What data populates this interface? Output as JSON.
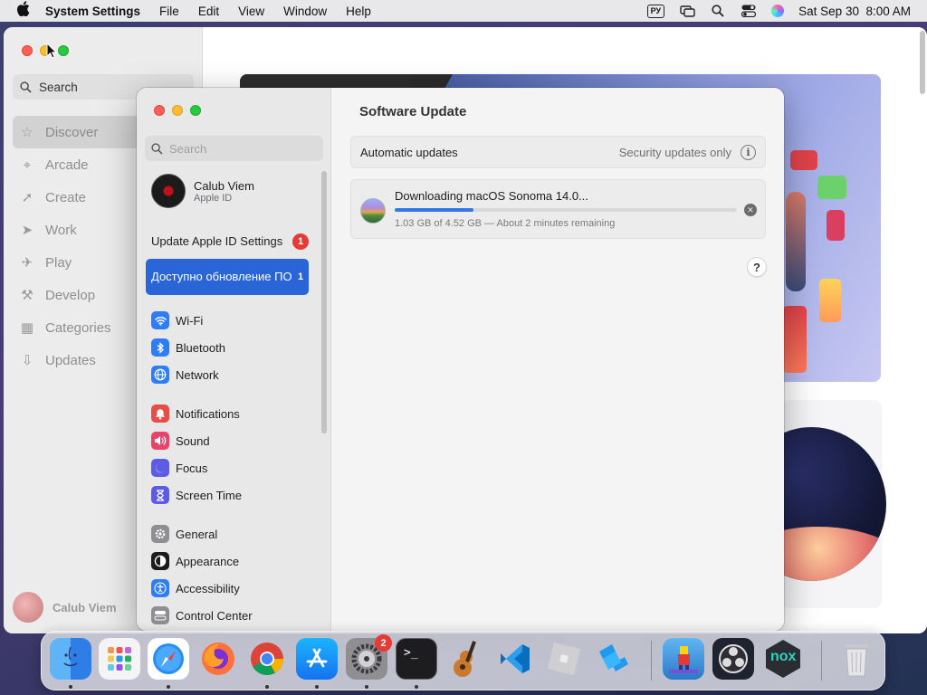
{
  "menubar": {
    "app_name": "System Settings",
    "menus": [
      "File",
      "Edit",
      "View",
      "Window",
      "Help"
    ],
    "input_source": "РУ",
    "datetime": "Sat Sep 30  8:00 AM"
  },
  "appstore": {
    "search_placeholder": "Search",
    "nav": [
      {
        "label": "Discover",
        "icon": "star-icon",
        "active": true
      },
      {
        "label": "Arcade",
        "icon": "joystick-icon"
      },
      {
        "label": "Create",
        "icon": "paper-plane-icon"
      },
      {
        "label": "Work",
        "icon": "paper-plane-icon"
      },
      {
        "label": "Play",
        "icon": "rocket-icon"
      },
      {
        "label": "Develop",
        "icon": "hammer-icon"
      },
      {
        "label": "Categories",
        "icon": "grid-icon"
      },
      {
        "label": "Updates",
        "icon": "download-icon"
      }
    ],
    "user_name": "Calub Viem"
  },
  "settings": {
    "search_placeholder": "Search",
    "account": {
      "name": "Calub Viem",
      "subtitle": "Apple ID"
    },
    "update_apple_id": {
      "label": "Update Apple ID Settings",
      "badge": "1"
    },
    "software_update_row": {
      "label": "Доступно обновление ПО",
      "count": "1"
    },
    "sidebar_items": [
      {
        "label": "Wi-Fi",
        "icon": "wifi-icon",
        "color": "#2f7df6"
      },
      {
        "label": "Bluetooth",
        "icon": "bluetooth-icon",
        "color": "#2f7df6"
      },
      {
        "label": "Network",
        "icon": "globe-icon",
        "color": "#2f7df6"
      },
      {
        "label": "Notifications",
        "icon": "bell-icon",
        "color": "#e84c45"
      },
      {
        "label": "Sound",
        "icon": "speaker-icon",
        "color": "#e8436a"
      },
      {
        "label": "Focus",
        "icon": "moon-icon",
        "color": "#5e5ce6"
      },
      {
        "label": "Screen Time",
        "icon": "hourglass-icon",
        "color": "#5e5ce6"
      },
      {
        "label": "General",
        "icon": "gear-icon",
        "color": "#8e8e93"
      },
      {
        "label": "Appearance",
        "icon": "appearance-icon",
        "color": "#1c1c1e"
      },
      {
        "label": "Accessibility",
        "icon": "accessibility-icon",
        "color": "#2f7df6"
      },
      {
        "label": "Control Center",
        "icon": "control-center-icon",
        "color": "#8e8e93"
      }
    ],
    "content": {
      "title": "Software Update",
      "automatic_updates_label": "Automatic updates",
      "automatic_updates_value": "Security updates only",
      "download_title": "Downloading macOS Sonoma 14.0...",
      "download_progress": 0.23,
      "download_status": "1.03 GB of 4.52 GB — About 2 minutes remaining",
      "help": "?"
    }
  },
  "dock": {
    "apps": [
      {
        "name": "finder-icon",
        "running": true
      },
      {
        "name": "launchpad-icon",
        "running": false
      },
      {
        "name": "safari-icon",
        "running": true
      },
      {
        "name": "firefox-icon",
        "running": false
      },
      {
        "name": "chrome-icon",
        "running": true
      },
      {
        "name": "app-store-icon",
        "running": true
      },
      {
        "name": "system-settings-icon",
        "running": true,
        "badge": "2"
      },
      {
        "name": "terminal-icon",
        "running": true
      },
      {
        "name": "garageband-icon",
        "running": false
      },
      {
        "name": "vscode-icon",
        "running": false
      },
      {
        "name": "roblox-icon",
        "running": false
      },
      {
        "name": "roblox-studio-icon",
        "running": false
      },
      {
        "name": "subway-surfers-icon",
        "running": false
      },
      {
        "name": "obs-icon",
        "running": false
      },
      {
        "name": "nox-icon",
        "running": false
      },
      {
        "name": "trash-icon",
        "running": false
      }
    ],
    "nox_label": "nox"
  }
}
